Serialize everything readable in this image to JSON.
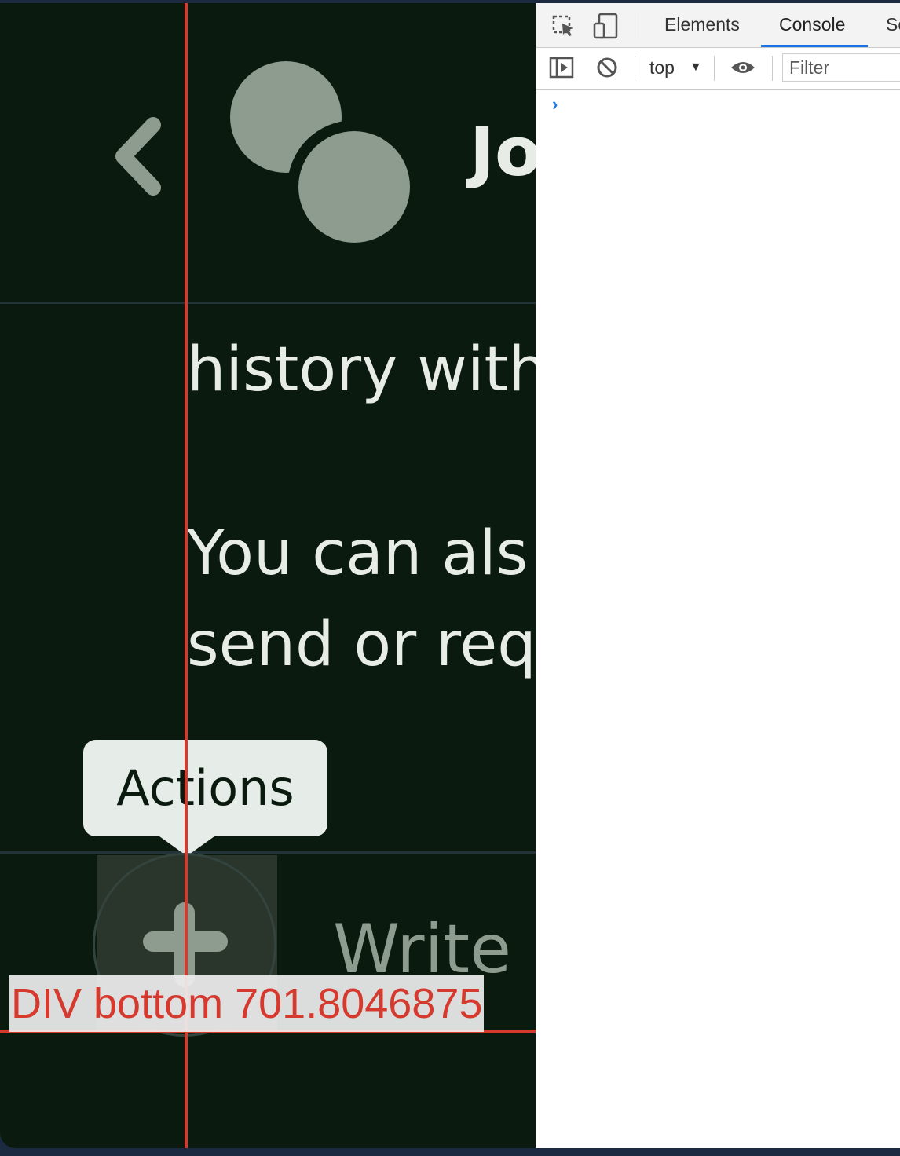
{
  "app": {
    "contact_name": "Jo",
    "messages": [
      "history with",
      "You can als",
      "send or req"
    ],
    "actions_tooltip": "Actions",
    "composer_placeholder": "Write s"
  },
  "inspector_overlay": {
    "label": "DIV bottom 701.8046875"
  },
  "devtools": {
    "tabs": [
      "Elements",
      "Console",
      "Sc"
    ],
    "active_tab": "Console",
    "context_selector": "top",
    "filter_placeholder": "Filter",
    "console_prompt": "›"
  },
  "colors": {
    "app_background": "#0b1a0e",
    "text_light": "#e7ece7",
    "muted_green": "#8d9c8f",
    "guide_red": "#d6392d",
    "devtools_accent": "#1a73e8"
  },
  "icons": {
    "back": "chevron-left-icon",
    "inspect": "inspect-element-icon",
    "device": "device-toolbar-icon",
    "sidebar": "console-sidebar-icon",
    "clear": "clear-console-icon",
    "eye": "live-expression-icon"
  }
}
